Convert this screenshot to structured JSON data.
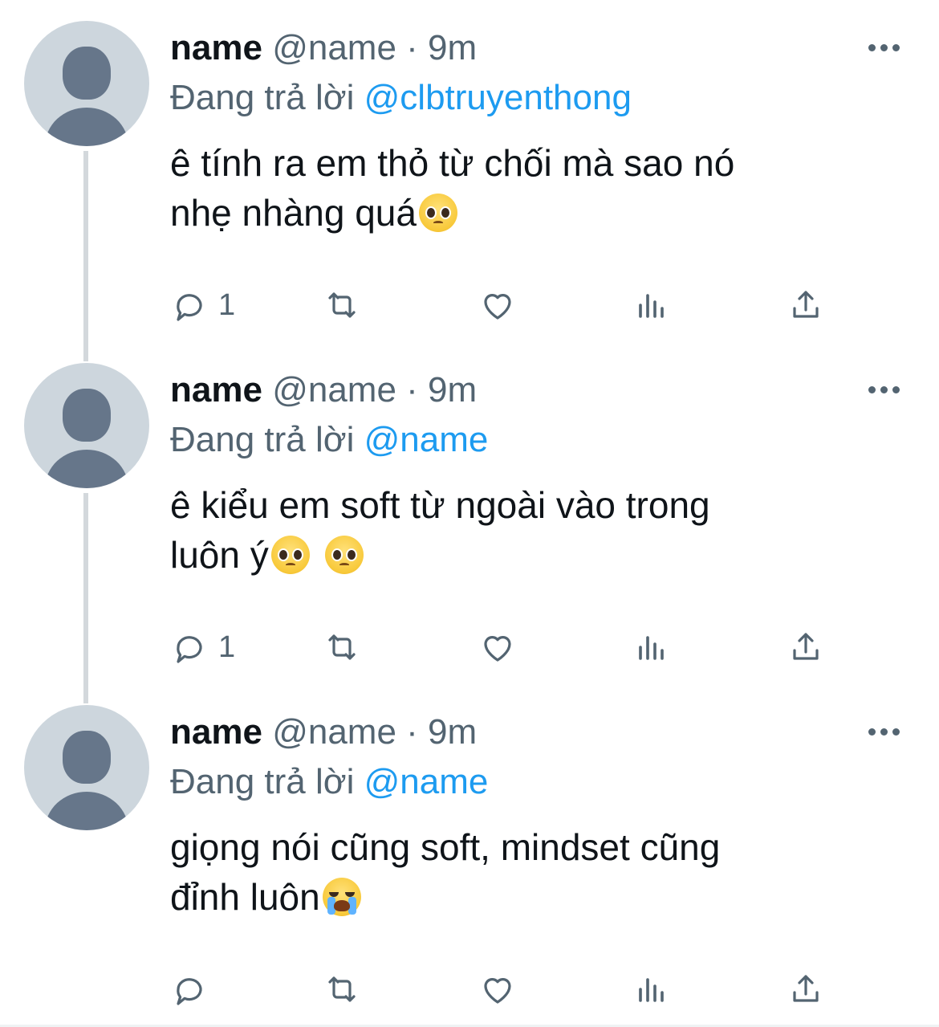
{
  "tweets": [
    {
      "name": "name",
      "handle": "@name",
      "separator": "·",
      "time": "9m",
      "replying_prefix": "Đang trả lời",
      "replying_to": "@clbtruyenthong",
      "text_line1": "ê tính ra em thỏ từ chối mà sao nó",
      "text_line2": "nhẹ nhàng quá",
      "emojis": [
        "pleading-face-emoji"
      ],
      "reply_count": "1"
    },
    {
      "name": "name",
      "handle": "@name",
      "separator": "·",
      "time": "9m",
      "replying_prefix": "Đang trả lời",
      "replying_to": "@name",
      "text_line1": "ê kiểu em soft từ ngoài vào trong",
      "text_line2": "luôn ý",
      "emojis": [
        "pleading-face-emoji",
        "pleading-face-emoji"
      ],
      "reply_count": "1"
    },
    {
      "name": "name",
      "handle": "@name",
      "separator": "·",
      "time": "9m",
      "replying_prefix": "Đang trả lời",
      "replying_to": "@name",
      "text_line1": "giọng nói cũng soft, mindset cũng",
      "text_line2": "đỉnh luôn",
      "emojis": [
        "loudly-crying-face-emoji"
      ],
      "reply_count": ""
    }
  ],
  "icons": {
    "reply": "reply-icon",
    "retweet": "retweet-icon",
    "like": "heart-icon",
    "views": "views-icon",
    "share": "share-icon",
    "more": "more-icon"
  },
  "colors": {
    "link": "#1d9bf0",
    "secondary_text": "#536471",
    "primary_text": "#0f1419",
    "avatar_bg": "#cdd6dd",
    "avatar_fg": "#66768a",
    "thread_line": "#d3d8dc"
  }
}
